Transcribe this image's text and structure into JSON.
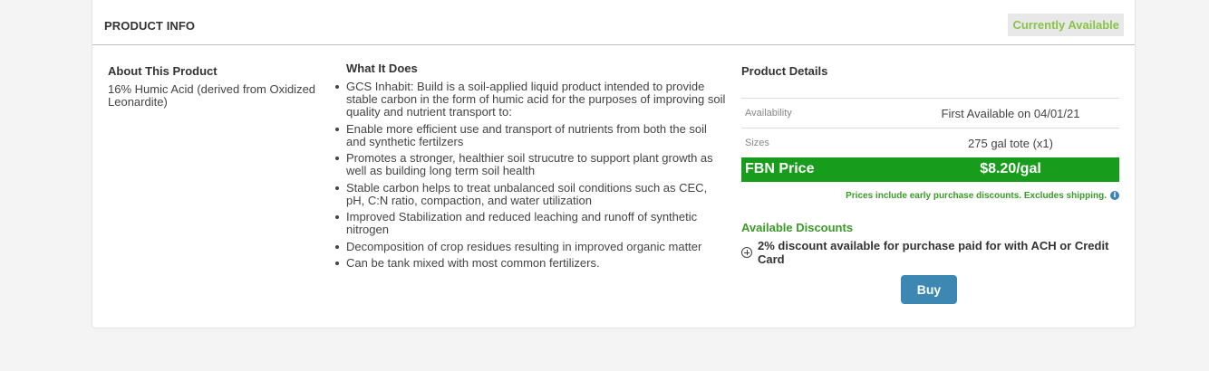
{
  "header": {
    "title": "PRODUCT INFO",
    "status": "Currently Available"
  },
  "about": {
    "title": "About This Product",
    "text": "16% Humic Acid (derived from Oxidized Leonardite)"
  },
  "what_it_does": {
    "title": "What It Does",
    "items": [
      "GCS Inhabit: Build is a soil-applied liquid product intended to provide stable carbon in the form of humic acid for the purposes of improving soil quality and nutrient transport to:",
      "Enable more efficient use and transport of nutrients from both the soil and synthetic fertilzers",
      "Promotes a stronger, healthier soil strucutre to support plant growth as well as building long term soil health",
      "Stable carbon helps to treat unbalanced soil conditions such as CEC, pH, C:N ratio, compaction, and water utilization",
      "Improved Stabilization and reduced leaching and runoff of synthetic nitrogen",
      "Decomposition of crop residues resulting in improved organic matter",
      "Can be tank mixed with most common fertilizers."
    ]
  },
  "details": {
    "title": "Product Details",
    "availability_label": "Availability",
    "availability_value": "First Available on 04/01/21",
    "sizes_label": "Sizes",
    "sizes_value": "275 gal tote (x1)",
    "price_label": "FBN Price",
    "price_value": "$8.20/gal",
    "price_note": "Prices include early purchase discounts. Excludes shipping.",
    "info_icon": "i"
  },
  "discounts": {
    "title": "Available Discounts",
    "item": "2% discount available for purchase paid for with ACH or Credit Card"
  },
  "buy_label": "Buy",
  "colors": {
    "price_bar": "#189c1c",
    "available_green": "#8bc34a",
    "discount_green": "#3a9b28",
    "buy_button": "#3d88b2"
  }
}
